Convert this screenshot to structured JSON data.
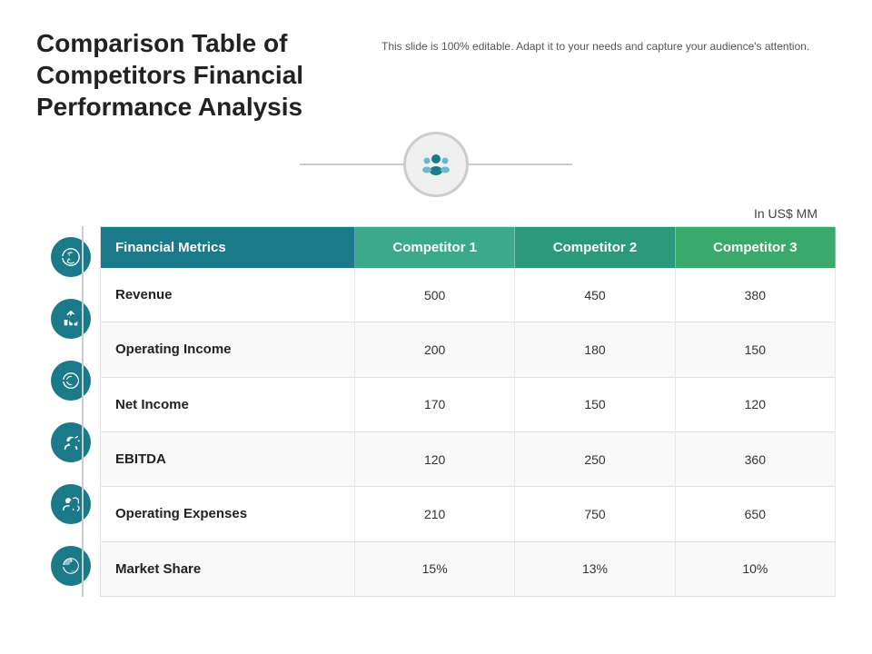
{
  "header": {
    "main_title": "Comparison Table of Competitors Financial Performance Analysis",
    "subtitle": "This slide is 100% editable. Adapt it to your needs and capture your audience's attention."
  },
  "currency_label": "In US$ MM",
  "table": {
    "columns": [
      {
        "id": "metric",
        "label": "Financial Metrics"
      },
      {
        "id": "comp1",
        "label": "Competitor 1"
      },
      {
        "id": "comp2",
        "label": "Competitor 2"
      },
      {
        "id": "comp3",
        "label": "Competitor 3"
      }
    ],
    "rows": [
      {
        "metric": "Revenue",
        "comp1": "500",
        "comp2": "450",
        "comp3": "380",
        "icon": "revenue"
      },
      {
        "metric": "Operating Income",
        "comp1": "200",
        "comp2": "180",
        "comp3": "150",
        "icon": "operating-income"
      },
      {
        "metric": "Net Income",
        "comp1": "170",
        "comp2": "150",
        "comp3": "120",
        "icon": "net-income"
      },
      {
        "metric": "EBITDA",
        "comp1": "120",
        "comp2": "250",
        "comp3": "360",
        "icon": "ebitda"
      },
      {
        "metric": "Operating Expenses",
        "comp1": "210",
        "comp2": "750",
        "comp3": "650",
        "icon": "operating-expenses"
      },
      {
        "metric": "Market Share",
        "comp1": "15%",
        "comp2": "13%",
        "comp3": "10%",
        "icon": "market-share"
      }
    ]
  },
  "colors": {
    "header_bg": "#1a7a8a",
    "comp1_bg": "#3aaa8a",
    "comp2_bg": "#2a9a7a",
    "comp3_bg": "#3aaa6a",
    "icon_circle": "#1a7a8a"
  }
}
